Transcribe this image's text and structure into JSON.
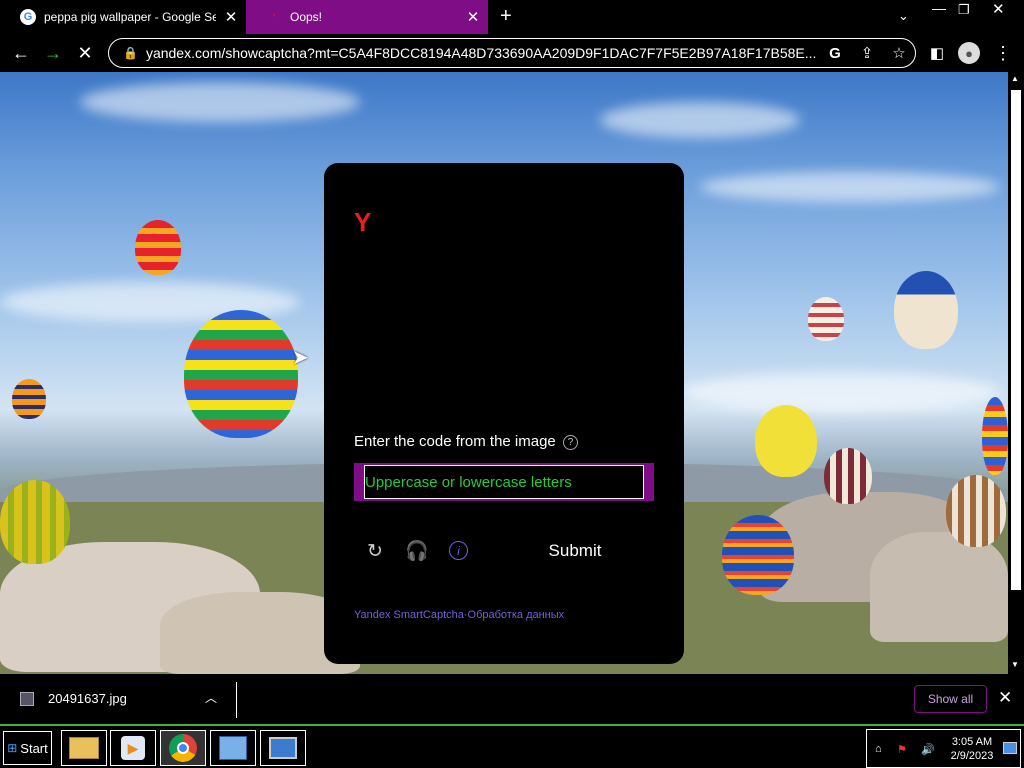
{
  "tabs": [
    {
      "title": "peppa pig wallpaper - Google Searc",
      "favicon": "google-icon",
      "active": false
    },
    {
      "title": "Oops!",
      "favicon": "yandex-icon",
      "active": true
    }
  ],
  "url": "yandex.com/showcaptcha?mt=C5A4F8DCC8194A48D733690AA209D9F1DAC7F7F5E2B97A18F17B58E...",
  "captcha": {
    "logo": "Y",
    "prompt": "Enter the code from the image",
    "input_placeholder": "Uppercase or lowercase letters",
    "submit_label": "Submit",
    "footer_link1": "Yandex SmartCaptcha",
    "footer_sep": "·",
    "footer_link2": "Обработка данных"
  },
  "download": {
    "filename": "20491637.jpg",
    "show_all": "Show all"
  },
  "taskbar": {
    "start_label": "Start",
    "time": "3:05 AM",
    "date": "2/9/2023"
  },
  "colors": {
    "accent": "#7f0d86",
    "yandex_red": "#ea1c24",
    "placeholder_green": "#27c93f",
    "link": "#6e62d9"
  }
}
